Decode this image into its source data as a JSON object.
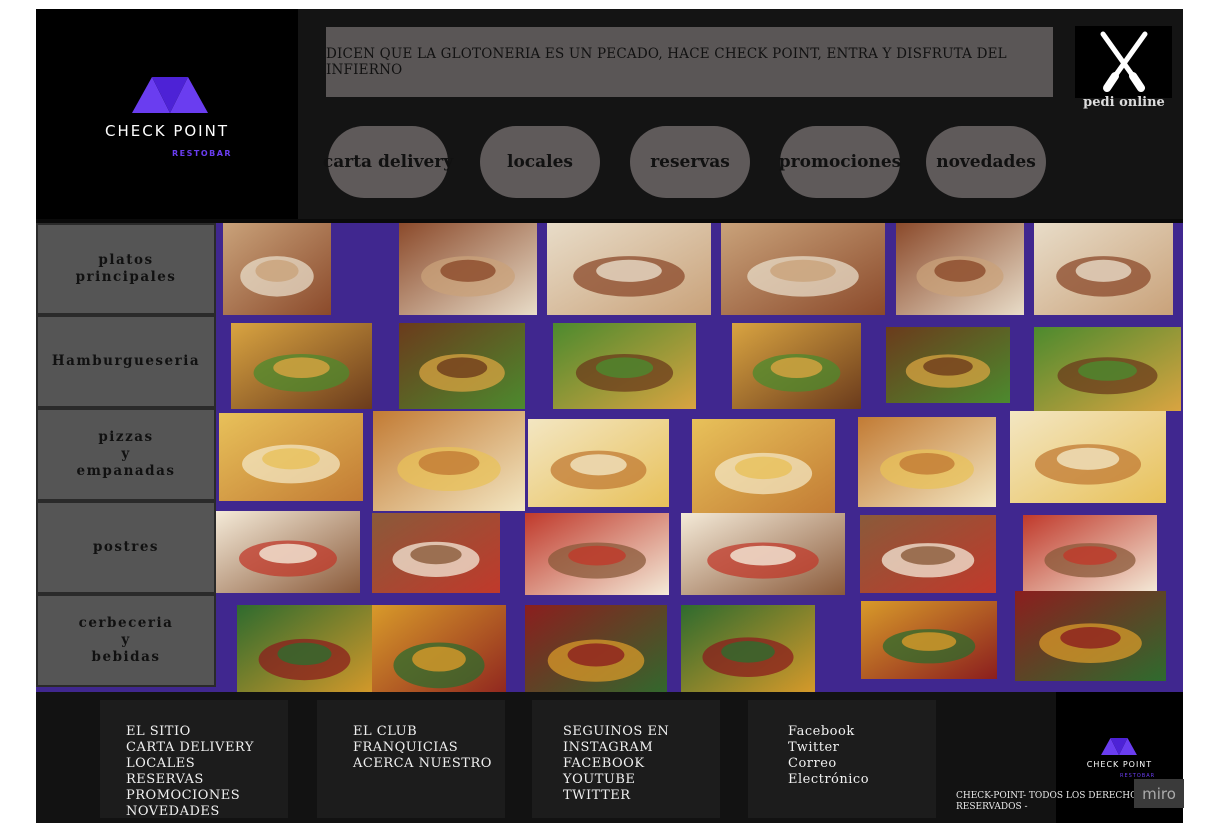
{
  "brand": {
    "name": "CHECK POINT",
    "sub": "RESTOBAR",
    "accent": "#6a3df0"
  },
  "header": {
    "slogan": "DICEN QUE LA GLOTONERIA ES UN PECADO, HACE CHECK POINT, ENTRA Y DISFRUTA DEL INFIERNO",
    "order_online": "pedi online",
    "nav": [
      "carta delivery",
      "locales",
      "reservas",
      "promociones",
      "novedades"
    ]
  },
  "categories": [
    "platos\nprincipales",
    "Hamburgueseria",
    "pizzas\ny\nempanadas",
    "postres",
    "cerbeceria\ny\nbebidas"
  ],
  "gallery": [
    [
      "dishes-collage",
      "salad-collage",
      "grilled-fish",
      "steak-plate",
      "salmon-dish",
      "roast-meat"
    ],
    [
      "classic-burger",
      "burger-plate",
      "burger-fries-board",
      "burger-basket",
      "burger-fries",
      "burger-wood"
    ],
    [
      "cheese-pizza",
      "empanadas",
      "pizza-table",
      "empanadas-cheese",
      "pizza-slices",
      "pizza-empanadas"
    ],
    [
      "desserts-collage",
      "mousse-cups",
      "cheesecake",
      "tiramisu",
      "ice-cream",
      "desserts-grid"
    ],
    [
      "heineken-bottles",
      "beer-mugs",
      "beer-bottles-row",
      "craft-beers",
      "tapas-table",
      "beer-lineup"
    ]
  ],
  "footer": {
    "col1": [
      "EL SITIO",
      "CARTA DELIVERY",
      "LOCALES",
      "RESERVAS",
      "PROMOCIONES",
      "NOVEDADES"
    ],
    "col2": [
      "EL CLUB",
      "FRANQUICIAS",
      "ACERCA NUESTRO"
    ],
    "col3": [
      "SEGUINOS EN",
      "INSTAGRAM",
      "FACEBOOK",
      "YOUTUBE",
      "TWITTER"
    ],
    "col4": [
      "Facebook",
      "Twitter",
      "Correo",
      "Electrónico"
    ],
    "copyright": "CHECK-POINT- TODOS LOS DERECHOS RESERVADOS -",
    "badge": "miro"
  }
}
